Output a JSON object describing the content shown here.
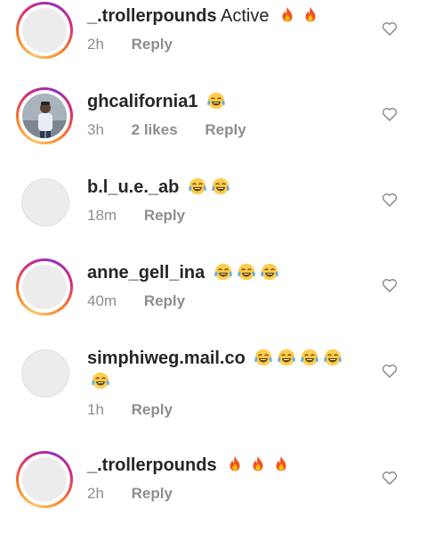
{
  "comments": [
    {
      "username": "_.trollerpounds",
      "text": "Active",
      "emojis": [
        "fire",
        "fire"
      ],
      "time": "2h",
      "likes": "",
      "reply": "Reply",
      "avatar": "ring"
    },
    {
      "username": "ghcalifornia1",
      "text": "",
      "emojis": [
        "joy"
      ],
      "time": "3h",
      "likes": "2 likes",
      "reply": "Reply",
      "avatar": "photo"
    },
    {
      "username": "b.l_u.e._ab",
      "text": "",
      "emojis": [
        "joy",
        "joy"
      ],
      "time": "18m",
      "likes": "",
      "reply": "Reply",
      "avatar": "plain"
    },
    {
      "username": "anne_gell_ina",
      "text": "",
      "emojis": [
        "joy",
        "joy",
        "joy"
      ],
      "time": "40m",
      "likes": "",
      "reply": "Reply",
      "avatar": "ring"
    },
    {
      "username": "simphiweg.mail.co",
      "text": "",
      "emojis": [
        "joy",
        "joy",
        "joy",
        "joy",
        "joy"
      ],
      "time": "1h",
      "likes": "",
      "reply": "Reply",
      "avatar": "plain"
    },
    {
      "username": "_.trollerpounds",
      "text": "",
      "emojis": [
        "fire",
        "fire",
        "fire"
      ],
      "time": "2h",
      "likes": "",
      "reply": "Reply",
      "avatar": "ring"
    }
  ],
  "icons": {
    "like": "heart-outline-icon",
    "fire": "fire-emoji-icon",
    "joy": "face-with-tears-of-joy-emoji-icon"
  },
  "colors": {
    "text": "#262626",
    "muted": "#8e8e8e",
    "ring_start": "#fdc468",
    "ring_end": "#962fbf"
  }
}
